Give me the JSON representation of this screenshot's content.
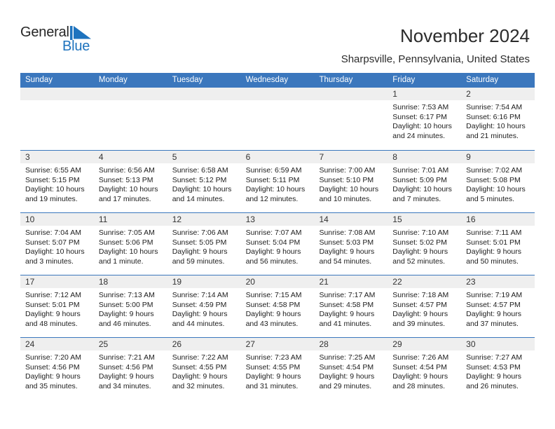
{
  "brand": {
    "name_part1": "General",
    "name_part2": "Blue",
    "flag_color": "#1e73be"
  },
  "header": {
    "title": "November 2024",
    "subtitle": "Sharpsville, Pennsylvania, United States",
    "accent_color": "#3b77bd",
    "daynum_band_color": "#efefef"
  },
  "calendar": {
    "weekdays": [
      "Sunday",
      "Monday",
      "Tuesday",
      "Wednesday",
      "Thursday",
      "Friday",
      "Saturday"
    ],
    "weeks": [
      [
        {
          "day": "",
          "empty": true
        },
        {
          "day": "",
          "empty": true
        },
        {
          "day": "",
          "empty": true
        },
        {
          "day": "",
          "empty": true
        },
        {
          "day": "",
          "empty": true
        },
        {
          "day": "1",
          "sunrise": "Sunrise: 7:53 AM",
          "sunset": "Sunset: 6:17 PM",
          "daylight_1": "Daylight: 10 hours",
          "daylight_2": "and 24 minutes."
        },
        {
          "day": "2",
          "sunrise": "Sunrise: 7:54 AM",
          "sunset": "Sunset: 6:16 PM",
          "daylight_1": "Daylight: 10 hours",
          "daylight_2": "and 21 minutes."
        }
      ],
      [
        {
          "day": "3",
          "sunrise": "Sunrise: 6:55 AM",
          "sunset": "Sunset: 5:15 PM",
          "daylight_1": "Daylight: 10 hours",
          "daylight_2": "and 19 minutes."
        },
        {
          "day": "4",
          "sunrise": "Sunrise: 6:56 AM",
          "sunset": "Sunset: 5:13 PM",
          "daylight_1": "Daylight: 10 hours",
          "daylight_2": "and 17 minutes."
        },
        {
          "day": "5",
          "sunrise": "Sunrise: 6:58 AM",
          "sunset": "Sunset: 5:12 PM",
          "daylight_1": "Daylight: 10 hours",
          "daylight_2": "and 14 minutes."
        },
        {
          "day": "6",
          "sunrise": "Sunrise: 6:59 AM",
          "sunset": "Sunset: 5:11 PM",
          "daylight_1": "Daylight: 10 hours",
          "daylight_2": "and 12 minutes."
        },
        {
          "day": "7",
          "sunrise": "Sunrise: 7:00 AM",
          "sunset": "Sunset: 5:10 PM",
          "daylight_1": "Daylight: 10 hours",
          "daylight_2": "and 10 minutes."
        },
        {
          "day": "8",
          "sunrise": "Sunrise: 7:01 AM",
          "sunset": "Sunset: 5:09 PM",
          "daylight_1": "Daylight: 10 hours",
          "daylight_2": "and 7 minutes."
        },
        {
          "day": "9",
          "sunrise": "Sunrise: 7:02 AM",
          "sunset": "Sunset: 5:08 PM",
          "daylight_1": "Daylight: 10 hours",
          "daylight_2": "and 5 minutes."
        }
      ],
      [
        {
          "day": "10",
          "sunrise": "Sunrise: 7:04 AM",
          "sunset": "Sunset: 5:07 PM",
          "daylight_1": "Daylight: 10 hours",
          "daylight_2": "and 3 minutes."
        },
        {
          "day": "11",
          "sunrise": "Sunrise: 7:05 AM",
          "sunset": "Sunset: 5:06 PM",
          "daylight_1": "Daylight: 10 hours",
          "daylight_2": "and 1 minute."
        },
        {
          "day": "12",
          "sunrise": "Sunrise: 7:06 AM",
          "sunset": "Sunset: 5:05 PM",
          "daylight_1": "Daylight: 9 hours",
          "daylight_2": "and 59 minutes."
        },
        {
          "day": "13",
          "sunrise": "Sunrise: 7:07 AM",
          "sunset": "Sunset: 5:04 PM",
          "daylight_1": "Daylight: 9 hours",
          "daylight_2": "and 56 minutes."
        },
        {
          "day": "14",
          "sunrise": "Sunrise: 7:08 AM",
          "sunset": "Sunset: 5:03 PM",
          "daylight_1": "Daylight: 9 hours",
          "daylight_2": "and 54 minutes."
        },
        {
          "day": "15",
          "sunrise": "Sunrise: 7:10 AM",
          "sunset": "Sunset: 5:02 PM",
          "daylight_1": "Daylight: 9 hours",
          "daylight_2": "and 52 minutes."
        },
        {
          "day": "16",
          "sunrise": "Sunrise: 7:11 AM",
          "sunset": "Sunset: 5:01 PM",
          "daylight_1": "Daylight: 9 hours",
          "daylight_2": "and 50 minutes."
        }
      ],
      [
        {
          "day": "17",
          "sunrise": "Sunrise: 7:12 AM",
          "sunset": "Sunset: 5:01 PM",
          "daylight_1": "Daylight: 9 hours",
          "daylight_2": "and 48 minutes."
        },
        {
          "day": "18",
          "sunrise": "Sunrise: 7:13 AM",
          "sunset": "Sunset: 5:00 PM",
          "daylight_1": "Daylight: 9 hours",
          "daylight_2": "and 46 minutes."
        },
        {
          "day": "19",
          "sunrise": "Sunrise: 7:14 AM",
          "sunset": "Sunset: 4:59 PM",
          "daylight_1": "Daylight: 9 hours",
          "daylight_2": "and 44 minutes."
        },
        {
          "day": "20",
          "sunrise": "Sunrise: 7:15 AM",
          "sunset": "Sunset: 4:58 PM",
          "daylight_1": "Daylight: 9 hours",
          "daylight_2": "and 43 minutes."
        },
        {
          "day": "21",
          "sunrise": "Sunrise: 7:17 AM",
          "sunset": "Sunset: 4:58 PM",
          "daylight_1": "Daylight: 9 hours",
          "daylight_2": "and 41 minutes."
        },
        {
          "day": "22",
          "sunrise": "Sunrise: 7:18 AM",
          "sunset": "Sunset: 4:57 PM",
          "daylight_1": "Daylight: 9 hours",
          "daylight_2": "and 39 minutes."
        },
        {
          "day": "23",
          "sunrise": "Sunrise: 7:19 AM",
          "sunset": "Sunset: 4:57 PM",
          "daylight_1": "Daylight: 9 hours",
          "daylight_2": "and 37 minutes."
        }
      ],
      [
        {
          "day": "24",
          "sunrise": "Sunrise: 7:20 AM",
          "sunset": "Sunset: 4:56 PM",
          "daylight_1": "Daylight: 9 hours",
          "daylight_2": "and 35 minutes."
        },
        {
          "day": "25",
          "sunrise": "Sunrise: 7:21 AM",
          "sunset": "Sunset: 4:56 PM",
          "daylight_1": "Daylight: 9 hours",
          "daylight_2": "and 34 minutes."
        },
        {
          "day": "26",
          "sunrise": "Sunrise: 7:22 AM",
          "sunset": "Sunset: 4:55 PM",
          "daylight_1": "Daylight: 9 hours",
          "daylight_2": "and 32 minutes."
        },
        {
          "day": "27",
          "sunrise": "Sunrise: 7:23 AM",
          "sunset": "Sunset: 4:55 PM",
          "daylight_1": "Daylight: 9 hours",
          "daylight_2": "and 31 minutes."
        },
        {
          "day": "28",
          "sunrise": "Sunrise: 7:25 AM",
          "sunset": "Sunset: 4:54 PM",
          "daylight_1": "Daylight: 9 hours",
          "daylight_2": "and 29 minutes."
        },
        {
          "day": "29",
          "sunrise": "Sunrise: 7:26 AM",
          "sunset": "Sunset: 4:54 PM",
          "daylight_1": "Daylight: 9 hours",
          "daylight_2": "and 28 minutes."
        },
        {
          "day": "30",
          "sunrise": "Sunrise: 7:27 AM",
          "sunset": "Sunset: 4:53 PM",
          "daylight_1": "Daylight: 9 hours",
          "daylight_2": "and 26 minutes."
        }
      ]
    ]
  }
}
